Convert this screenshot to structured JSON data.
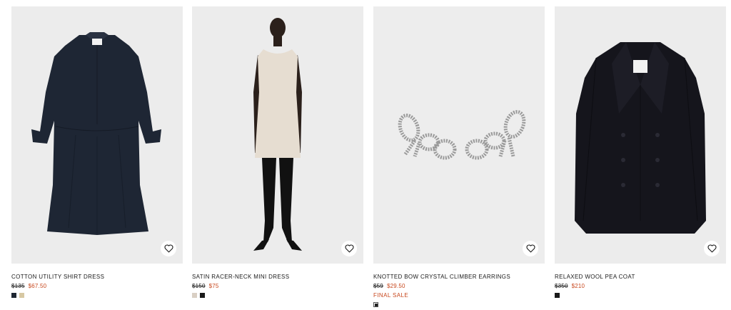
{
  "products": [
    {
      "name": "COTTON UTILITY SHIRT DRESS",
      "old_price": "$135",
      "new_price": "$67.50",
      "sale_label": "",
      "image_icon": "navy-shirt-dress-image",
      "swatches": [
        "#1f2733",
        "#d7c8a3"
      ]
    },
    {
      "name": "SATIN RACER-NECK MINI DRESS",
      "old_price": "$150",
      "new_price": "$75",
      "sale_label": "",
      "image_icon": "satin-mini-dress-image",
      "swatches": [
        "#d9cfc4",
        "#1a1a1a"
      ]
    },
    {
      "name": "KNOTTED BOW CRYSTAL CLIMBER EARRINGS",
      "old_price": "$59",
      "new_price": "$29.50",
      "sale_label": "FINAL SALE",
      "image_icon": "crystal-bow-earrings-image",
      "swatches": [
        "multi"
      ]
    },
    {
      "name": "RELAXED WOOL PEA COAT",
      "old_price": "$350",
      "new_price": "$210",
      "sale_label": "",
      "image_icon": "wool-pea-coat-image",
      "swatches": [
        "#1a1a1a"
      ]
    }
  ],
  "colors": {
    "sale": "#c8481e",
    "image_bg": "#efefef"
  },
  "favorite_icon": "heart-icon"
}
